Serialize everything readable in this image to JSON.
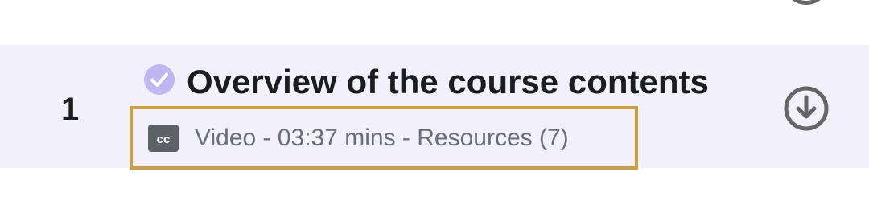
{
  "lecture": {
    "number": "1",
    "title": "Overview of the course contents",
    "completed": true,
    "meta": "Video - 03:37 mins - Resources (7)"
  },
  "icons": {
    "completed": "check-circle-icon",
    "captions": "closed-captions-icon",
    "download": "download-circle-icon"
  },
  "colors": {
    "row_background": "#f1f0fb",
    "check_fill": "#c0b6f2",
    "highlight_border": "#cf9f3d",
    "muted_text": "#6a6f73",
    "icon_gray": "#666666"
  }
}
